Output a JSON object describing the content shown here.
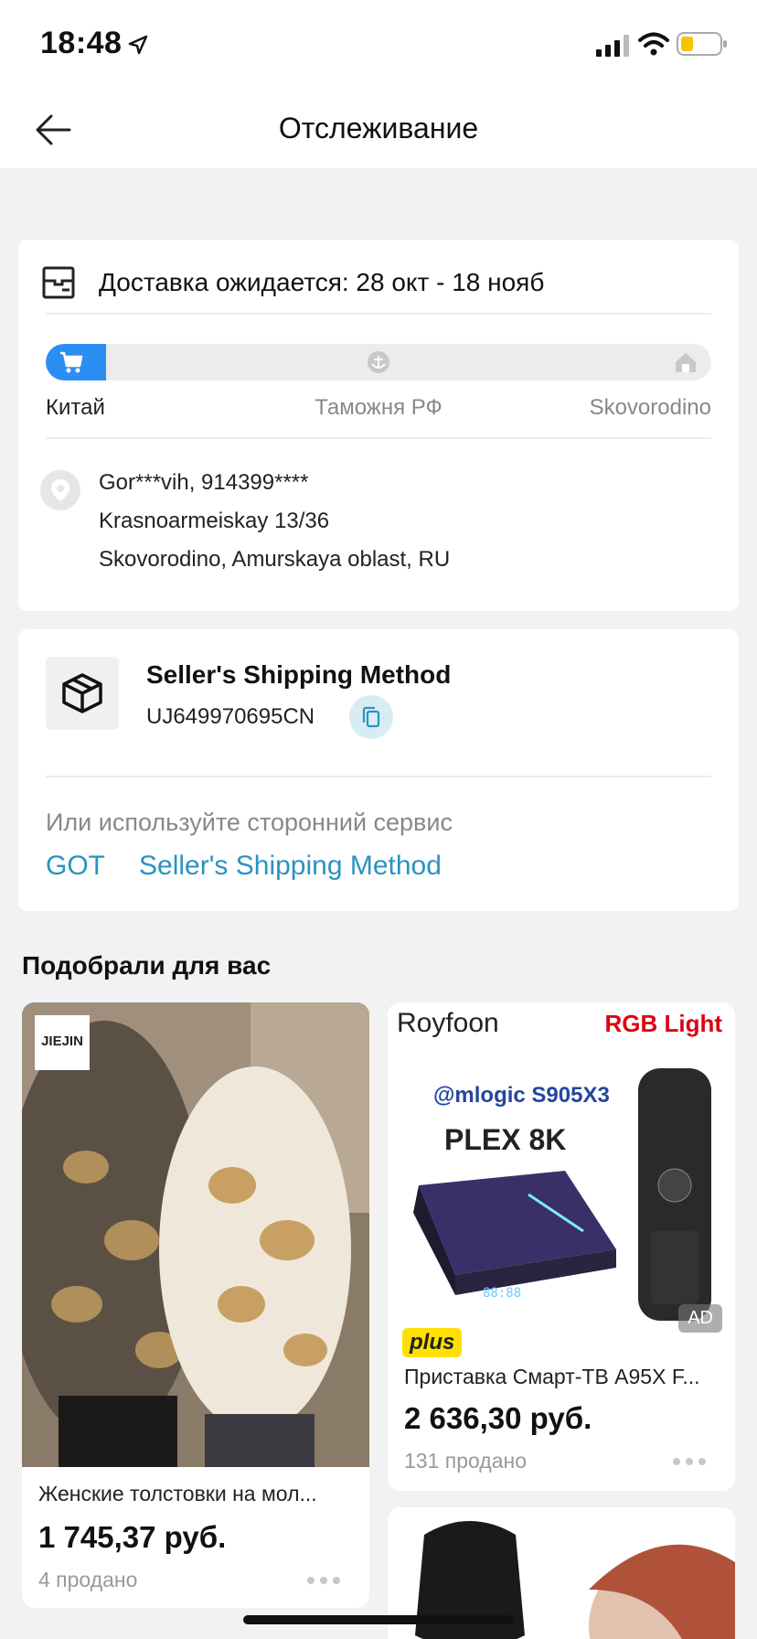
{
  "status": {
    "time": "18:48"
  },
  "nav": {
    "title": "Отслеживание"
  },
  "delivery": {
    "expected": "Доставка ожидается: 28 окт - 18 нояб",
    "progress_fraction": 0.09,
    "stages": [
      "Китай",
      "Таможня РФ",
      "Skovorodino"
    ],
    "address_lines": [
      "Gor***vih, 914399****",
      "Krasnoarmeiskay 13/36",
      "Skovorodino, Amurskaya oblast, RU"
    ]
  },
  "shipping": {
    "method": "Seller's Shipping Method",
    "tracking": "UJ649970695CN",
    "alt_text": "Или используйте сторонний сервис",
    "services": [
      "GOT",
      "Seller's Shipping Method"
    ]
  },
  "recommend": {
    "title": "Подобрали для вас",
    "products": [
      {
        "name": "Женские толстовки на мол...",
        "price": "1 745,37 руб.",
        "sold": "4 продано",
        "brand_tag": "JIEJIN"
      },
      {
        "name": "Приставка Смарт-ТВ A95X F...",
        "price": "2 636,30 руб.",
        "sold": "131 продано",
        "badge": "plus",
        "ad": "AD",
        "img_texts": {
          "brand": "Royfoon",
          "rgb": "RGB Light",
          "chip": "@mlogic S905X3",
          "plex": "PLEX 8K",
          "display": "88:88"
        }
      }
    ]
  },
  "colors": {
    "accent": "#2b8ef3",
    "link": "#2a93c0",
    "bg": "#f2f2f2"
  }
}
